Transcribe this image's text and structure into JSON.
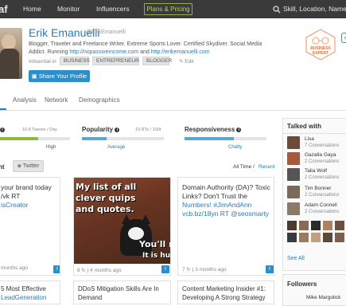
{
  "nav": {
    "logo": "af",
    "home": "Home",
    "monitor": "Monitor",
    "influencers": "Influencers",
    "plans": "Plans & Pricing",
    "search_text": "Skill, Location, Name"
  },
  "profile": {
    "name": "Erik Emanuelli",
    "handle": "@ErikEmanuelli",
    "bio": "Blogger, Traveler and Freelance Writer. Extreme Sports Lover. Certified Skydiver. Social Media Addict. Running",
    "bio_link": "http://nopassiveincome.com",
    "bio_link2": "http://erikemanuelli.com",
    "influential_label": "Influential in",
    "tags": [
      "BUSINESS",
      "ENTREPRENEUR",
      "BLOGGER"
    ],
    "edit": "Edit",
    "share_button": "Share Your Profile",
    "badge_label_1": "BUSINESS",
    "badge_label_2": "EXPERT",
    "badge_tab": "‹"
  },
  "tabs": [
    "Analysis",
    "Network",
    "Demographics"
  ],
  "metrics": [
    {
      "title": "",
      "side": "10.8 Tweets / Day",
      "sub": "High",
      "fill": 0.55,
      "color": "#8dbb3c",
      "sub_color": "#555"
    },
    {
      "title": "Popularity",
      "side": "19 RTs / 100t",
      "sub": "Average",
      "fill": 0.3,
      "color": "#5aa7d6",
      "sub_color": "#2a7db5"
    },
    {
      "title": "Responsiveness",
      "side": "",
      "sub": "Chatty",
      "fill": 0.6,
      "color": "#5aa7d6",
      "sub_color": "#2a7db5"
    }
  ],
  "content": {
    "filter_title": "nt",
    "twitter_button": "Twitter",
    "all_time": "All Time",
    "separator": "/",
    "recent": "Recent"
  },
  "cards": [
    {
      "lines": [
        "your brand today",
        "/vk RT",
        "isCreator"
      ],
      "meta": "months ago"
    },
    {
      "meme_lines": [
        "My list of all",
        "clever quips",
        "and quotes."
      ],
      "meme_bottom": "You'll no",
      "meme_bottom2": "It is hu",
      "meta": "8 ↻ | 4 months ago"
    },
    {
      "lines": [
        "Domain Authority (DA)? Toxic",
        "Links? Don't Trust the",
        "Numbers! #JimAndAnn",
        "vcb.bz/18yn RT @seosmarty"
      ],
      "meta": "7 ↻ | 3 months ago"
    },
    {
      "lines": [
        "5 Most Effective",
        "LeadGeneration Ideas"
      ],
      "meta": ""
    },
    {
      "lines": [
        "DDoS Mitigation Skills Are In",
        "Demand"
      ],
      "meta": ""
    },
    {
      "lines": [
        "Content Marketing Insider #1:",
        "Developing A Strong Strategy"
      ],
      "meta": ""
    }
  ],
  "talked_with": {
    "title": "Talked with",
    "people": [
      {
        "name": "Lisa",
        "conv": "7 Conversations",
        "color": "#6b4a3a"
      },
      {
        "name": "Gazalla Gaya",
        "conv": "2 Conversations",
        "color": "#a45a3c"
      },
      {
        "name": "Talia Wolf",
        "conv": "2 Conversations",
        "color": "#555555"
      },
      {
        "name": "Tim Bonner",
        "conv": "2 Conversations",
        "color": "#7a6a5a"
      },
      {
        "name": "Adam Connell",
        "conv": "2 Conversations",
        "color": "#8a7a6a"
      }
    ],
    "see_all": "See All"
  },
  "followers": {
    "title": "Followers",
    "first": "Mike Margolick"
  }
}
